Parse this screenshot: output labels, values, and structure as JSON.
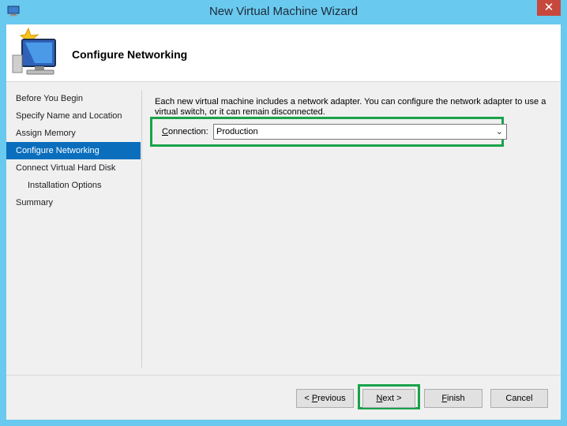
{
  "window": {
    "title": "New Virtual Machine Wizard",
    "close_glyph": "✕"
  },
  "banner": {
    "title": "Configure Networking"
  },
  "nav": {
    "items": [
      {
        "label": "Before You Begin"
      },
      {
        "label": "Specify Name and Location"
      },
      {
        "label": "Assign Memory"
      },
      {
        "label": "Configure Networking"
      },
      {
        "label": "Connect Virtual Hard Disk"
      },
      {
        "label": "Installation Options"
      },
      {
        "label": "Summary"
      }
    ],
    "selected_index": 3
  },
  "content": {
    "description": "Each new virtual machine includes a network adapter. You can configure the network adapter to use a virtual switch, or it can remain disconnected.",
    "connection_label": "Connection:",
    "connection_value": "Production"
  },
  "buttons": {
    "previous": "< Previous",
    "next": "Next >",
    "finish": "Finish",
    "cancel": "Cancel"
  },
  "colors": {
    "titlebar": "#6ac9ee",
    "selected_nav": "#0a6ebd",
    "highlight": "#19a34a",
    "close": "#c7493d"
  }
}
